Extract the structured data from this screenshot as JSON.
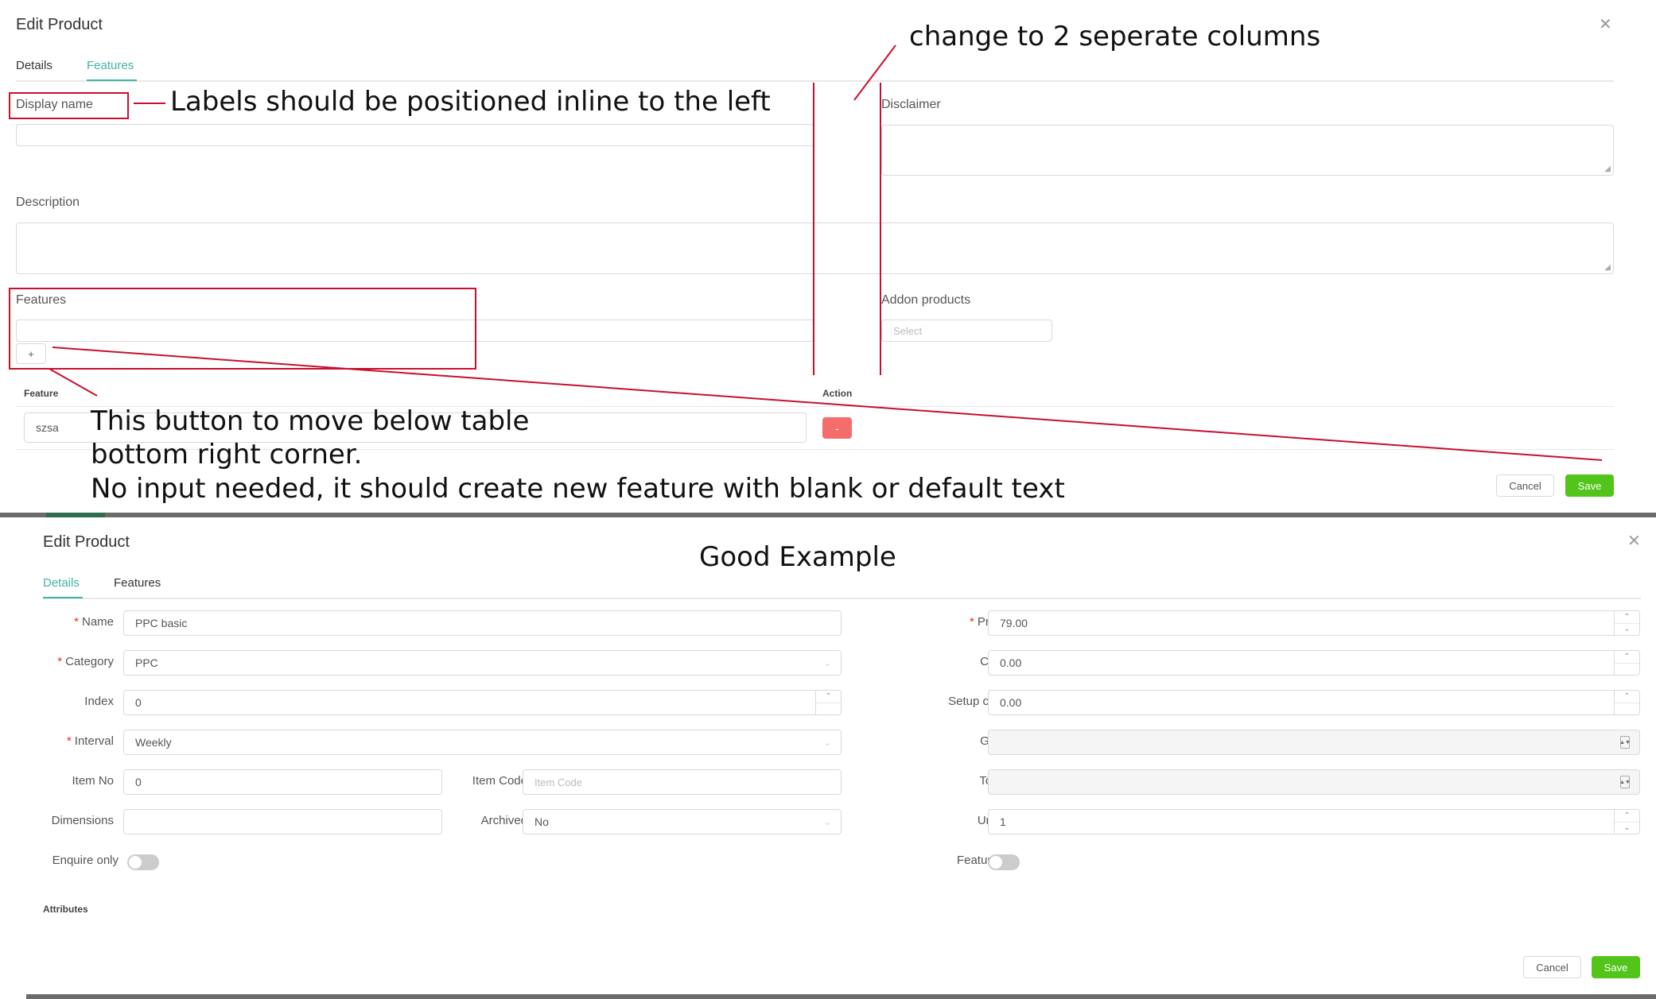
{
  "top": {
    "title": "Edit Product",
    "tabs": [
      {
        "label": "Details",
        "active": false
      },
      {
        "label": "Features",
        "active": true
      }
    ],
    "display_name_label": "Display name",
    "disclaimer_label": "Disclaimer",
    "description_label": "Description",
    "features_label": "Features",
    "addon_label": "Addon products",
    "addon_placeholder": "Select",
    "add_button": "+",
    "table": {
      "columns": [
        "Feature",
        "Action"
      ],
      "rows": [
        {
          "feature": "szsa",
          "action": "-"
        }
      ]
    },
    "cancel": "Cancel",
    "save": "Save"
  },
  "annotations": {
    "columns": "change to 2 seperate columns",
    "labels": "Labels should be positioned inline to the left",
    "button_line1": "This button to move below table",
    "button_line2": "bottom right corner.",
    "button_line3": "No input needed, it should create new feature with blank or default text",
    "good_example": "Good Example"
  },
  "bottom": {
    "title": "Edit Product",
    "tabs": [
      {
        "label": "Details",
        "active": true
      },
      {
        "label": "Features",
        "active": false
      }
    ],
    "left_fields": {
      "name": {
        "label": "Name",
        "required": true,
        "value": "PPC basic"
      },
      "category": {
        "label": "Category",
        "required": true,
        "value": "PPC"
      },
      "index": {
        "label": "Index",
        "required": false,
        "value": "0"
      },
      "interval": {
        "label": "Interval",
        "required": true,
        "value": "Weekly"
      },
      "item_no": {
        "label": "Item No",
        "value": "0"
      },
      "item_code": {
        "label": "Item Code",
        "placeholder": "Item Code"
      },
      "dimensions": {
        "label": "Dimensions",
        "value": ""
      },
      "archived": {
        "label": "Archived",
        "value": "No"
      },
      "enquire_only": {
        "label": "Enquire only",
        "on": false
      }
    },
    "right_fields": {
      "price": {
        "label": "Price",
        "required": true,
        "value": "79.00"
      },
      "cost": {
        "label": "Cost",
        "value": "0.00"
      },
      "setup_cost": {
        "label": "Setup cost",
        "value": "0.00"
      },
      "gst": {
        "label": "GST",
        "value": ""
      },
      "total": {
        "label": "Total",
        "value": ""
      },
      "units": {
        "label": "Units",
        "value": "1"
      },
      "featured": {
        "label": "Featured",
        "on": false
      }
    },
    "attributes_label": "Attributes",
    "cancel": "Cancel",
    "save": "Save"
  },
  "colors": {
    "accent": "#3fb4a2",
    "save_green": "#52c41a",
    "delete_red": "#f56c6c",
    "annotation_red": "#c8102e"
  }
}
